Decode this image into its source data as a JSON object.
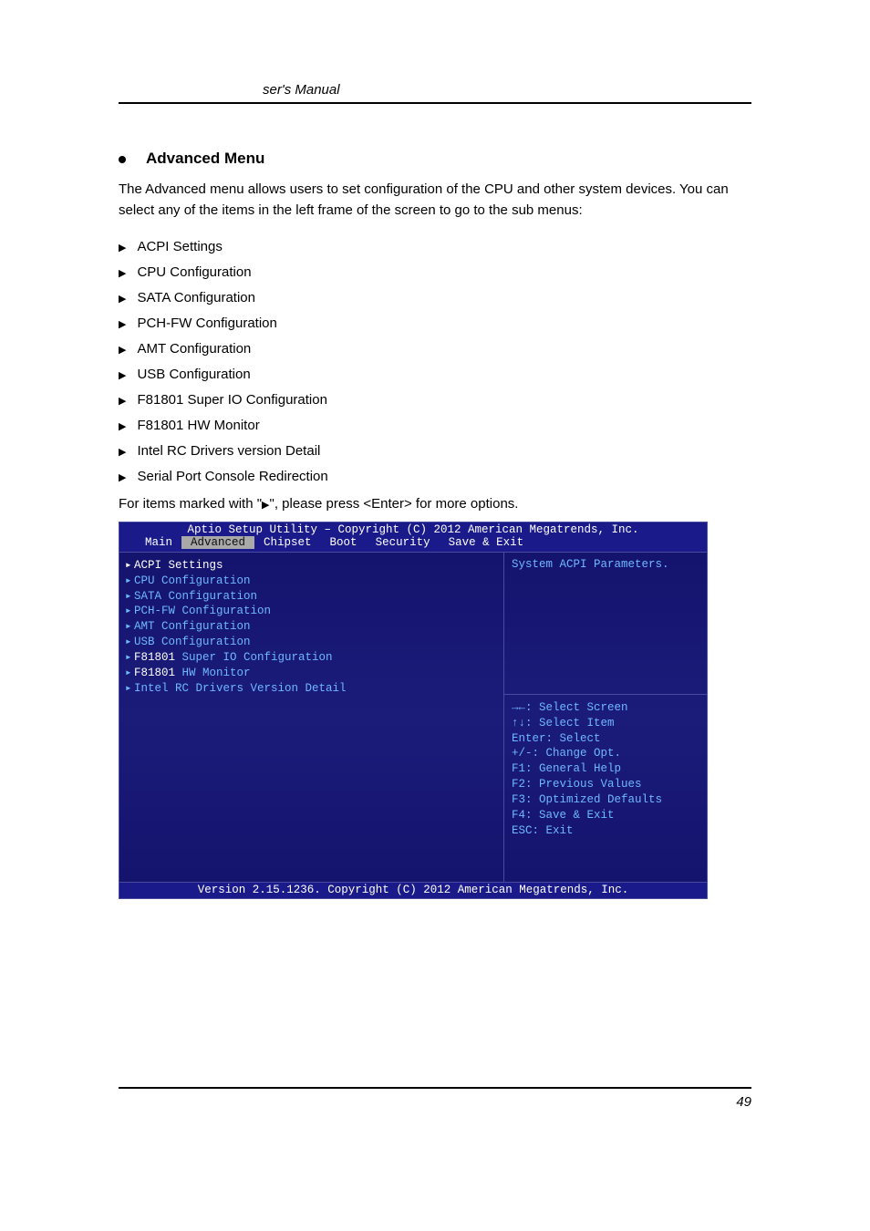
{
  "header": {
    "title": "ser's Manual"
  },
  "section": {
    "title": "Advanced Menu",
    "intro": "The Advanced menu allows users to set configuration of the CPU and other system devices. You can select any of the items in the left frame of the screen to go to the sub menus:",
    "items": [
      "ACPI Settings",
      "CPU Configuration",
      "SATA Configuration",
      "PCH-FW Configuration",
      "AMT Configuration",
      "USB Configuration",
      "F81801 Super IO Configuration",
      "F81801 HW Monitor",
      "Intel RC Drivers version Detail",
      "Serial Port Console Redirection"
    ],
    "note_prefix": "For items marked with \"",
    "note_suffix": "\", please press <Enter> for more options."
  },
  "bios": {
    "title": "Aptio Setup Utility – Copyright (C) 2012 American Megatrends, Inc.",
    "tabs": [
      "Main",
      "Advanced",
      "Chipset",
      "Boot",
      "Security",
      "Save & Exit"
    ],
    "active_tab": "Advanced",
    "menu": [
      {
        "label": "ACPI Settings",
        "selected": true
      },
      {
        "label": "CPU Configuration",
        "selected": false
      },
      {
        "label": "SATA Configuration",
        "selected": false
      },
      {
        "label": "PCH-FW Configuration",
        "selected": false
      },
      {
        "label": "AMT Configuration",
        "selected": false
      },
      {
        "label": "USB Configuration",
        "selected": false
      },
      {
        "label": "F81801 Super IO Configuration",
        "selected": false
      },
      {
        "label": "F81801 HW Monitor",
        "selected": false
      },
      {
        "label": "Intel RC Drivers Version Detail",
        "selected": false
      }
    ],
    "help_top": "System ACPI Parameters.",
    "help_bottom": [
      "→←: Select Screen",
      "↑↓: Select Item",
      "Enter: Select",
      "+/-: Change Opt.",
      "F1: General Help",
      "F2: Previous Values",
      "F3: Optimized Defaults",
      "F4: Save & Exit",
      "ESC: Exit"
    ],
    "footer": "Version 2.15.1236. Copyright (C) 2012 American Megatrends, Inc."
  },
  "page_number": "49"
}
